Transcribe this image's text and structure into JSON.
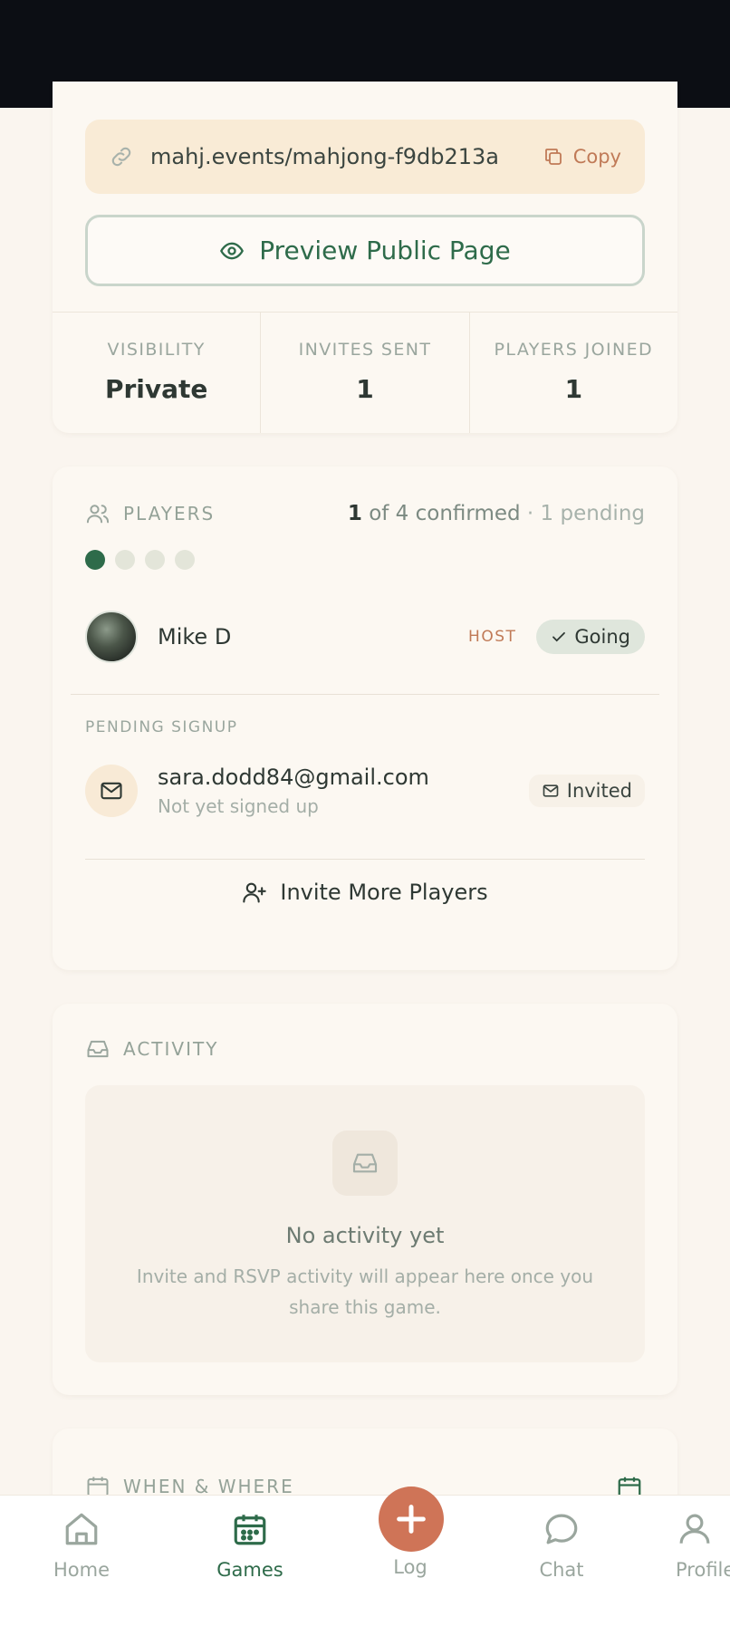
{
  "share": {
    "link": "mahj.events/mahjong-f9db213a",
    "copy_label": "Copy",
    "preview_label": "Preview Public Page"
  },
  "stats": [
    {
      "label": "VISIBILITY",
      "value": "Private"
    },
    {
      "label": "INVITES SENT",
      "value": "1"
    },
    {
      "label": "PLAYERS JOINED",
      "value": "1"
    }
  ],
  "players": {
    "title": "PLAYERS",
    "confirmed_count": "1",
    "confirmed_rest": " of 4 confirmed",
    "pending_text": " · 1 pending",
    "slots_filled": 1,
    "slots_total": 4,
    "host": {
      "name": "Mike D",
      "badge": "HOST",
      "status": "Going"
    },
    "pending_label": "PENDING SIGNUP",
    "pending": {
      "email": "sara.dodd84@gmail.com",
      "sub": "Not yet signed up",
      "status": "Invited"
    },
    "invite_more_label": "Invite More Players"
  },
  "activity": {
    "title": "ACTIVITY",
    "empty_title": "No activity yet",
    "empty_sub": "Invite and RSVP activity will appear here once you share this game."
  },
  "when_where": {
    "title": "WHEN & WHERE"
  },
  "tabbar": {
    "home": "Home",
    "games": "Games",
    "log": "Log",
    "chat": "Chat",
    "profile": "Profile"
  },
  "colors": {
    "accent": "#2e6b4a",
    "terracotta": "#cf7457",
    "background": "#faf5ef"
  }
}
